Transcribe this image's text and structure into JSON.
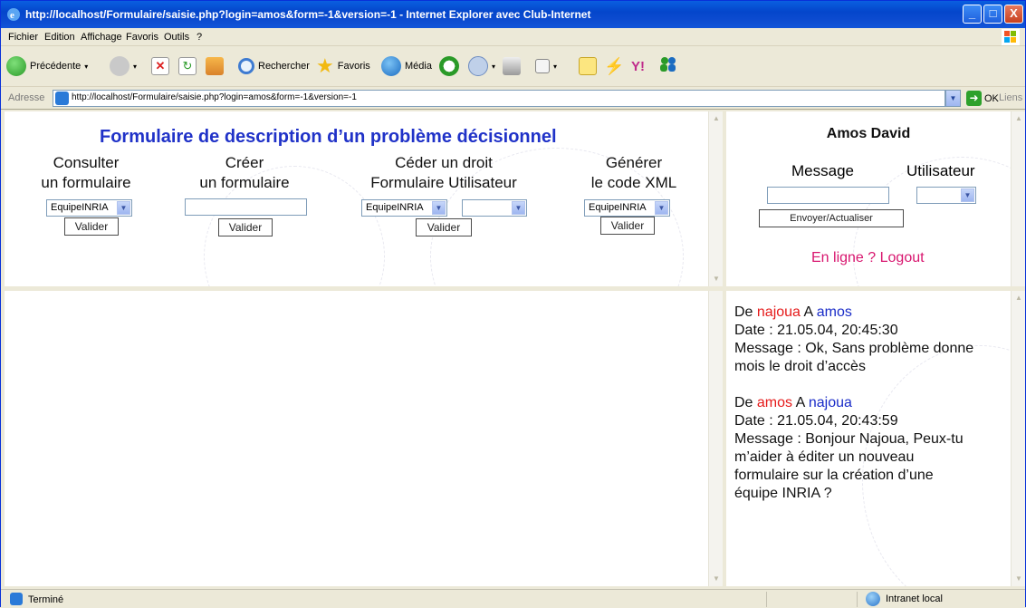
{
  "window": {
    "title": "http://localhost/Formulaire/saisie.php?login=amos&form=-1&version=-1 - Internet Explorer avec Club-Internet",
    "controls": {
      "minimize": "_",
      "maximize": "□",
      "close": "X"
    }
  },
  "menu": [
    "Fichier",
    "Edition",
    "Affichage",
    "Favoris",
    "Outils",
    "?"
  ],
  "toolbar": {
    "back": "Précédente",
    "search": "Rechercher",
    "favorites": "Favoris",
    "media": "Média"
  },
  "address": {
    "label": "Adresse",
    "url": "http://localhost/Formulaire/saisie.php?login=amos&form=-1&version=-1",
    "go": "OK",
    "links": "Liens"
  },
  "form_frame": {
    "title": "Formulaire de description d’un problème décisionnel",
    "columns": [
      {
        "line1": "Consulter",
        "line2": "un formulaire",
        "select": "EquipeINRIA",
        "button": "Valider"
      },
      {
        "line1": "Créer",
        "line2": "un formulaire",
        "input": "",
        "button": "Valider"
      },
      {
        "line1": "Céder un droit",
        "line2": "Formulaire Utilisateur",
        "select": "EquipeINRIA",
        "select2": "",
        "button": "Valider"
      },
      {
        "line1": "Générer",
        "line2": "le code XML",
        "select": "EquipeINRIA",
        "button": "Valider"
      }
    ]
  },
  "user_frame": {
    "name": "Amos David",
    "message_label": "Message",
    "user_label": "Utilisateur",
    "message_value": "",
    "user_value": "",
    "send_button": "Envoyer/Actualiser",
    "online_link": "En ligne ?",
    "logout_link": "Logout"
  },
  "messages": [
    {
      "from_label": "De",
      "from": "najoua",
      "to_label": "A",
      "to": "amos",
      "date": "Date : 21.05.04, 20:45:30",
      "lines": [
        "Message : Ok, Sans problème donne",
        "mois le droit d’accès"
      ]
    },
    {
      "from_label": "De",
      "from": "amos",
      "to_label": "A",
      "to": "najoua",
      "date": "Date : 21.05.04, 20:43:59",
      "lines": [
        "Message : Bonjour Najoua, Peux-tu",
        "m’aider à éditer un nouveau",
        "formulaire sur la création d’une",
        "équipe INRIA ?"
      ]
    }
  ],
  "status": {
    "text": "Terminé",
    "zone": "Intranet local"
  },
  "colors": {
    "title_blue": "#2032C8",
    "online_pink": "#D8166F",
    "sender_red": "#E51A1A",
    "recipient_blue": "#1A2CC8"
  }
}
